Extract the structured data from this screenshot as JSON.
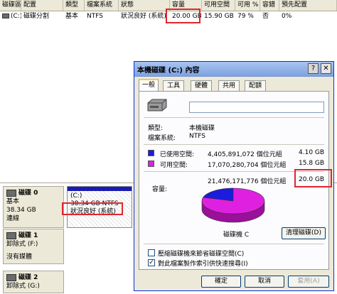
{
  "list": {
    "headers": [
      "磁碟區",
      "配置",
      "類型",
      "檔案系統",
      "狀態",
      "容量",
      "可用空間",
      "可用 %",
      "容錯",
      "預先配置"
    ],
    "row": [
      "(C:)",
      "磁碟分割",
      "基本",
      "NTFS",
      "狀況良好 (系統)",
      "20.00 GB",
      "15.90 GB",
      "79 %",
      "否",
      "0%"
    ]
  },
  "disks": [
    {
      "name": "磁碟 0",
      "type": "基本",
      "size": "38.34 GB",
      "status": "連線"
    },
    {
      "name": "磁碟 1",
      "type": "卸除式 (F:)",
      "size": "",
      "status": "沒有媒體"
    },
    {
      "name": "磁碟 2",
      "type": "卸除式 (G:)",
      "size": "",
      "status": ""
    }
  ],
  "partition": {
    "label": "(C:)",
    "size": "38.34 GB NTFS",
    "status": "狀況良好 (系統)"
  },
  "dialog": {
    "title": "本機磁碟 (C:) 內容",
    "tabs": [
      "一般",
      "工具",
      "硬體",
      "共用",
      "配額"
    ],
    "name_value": "",
    "type_label": "類型:",
    "type_value": "本機磁碟",
    "fs_label": "檔案系統:",
    "fs_value": "NTFS",
    "used_label": "已使用空間:",
    "used_bytes": "4,405,891,072 個位元組",
    "used_gb": "4.10 GB",
    "free_label": "可用空間:",
    "free_bytes": "17,070,280,704 個位元組",
    "free_gb": "15.8 GB",
    "cap_label": "容量:",
    "cap_bytes": "21,476,171,776 個位元組",
    "cap_gb": "20.0 GB",
    "drive_label": "磁碟機 C",
    "cleanup_button": "清理磁碟(D)",
    "compress_label": "壓縮磁碟機來節省磁碟空間(C)",
    "compress_checked": false,
    "index_label": "對此檔案製作索引供快速搜尋(I)",
    "index_checked": true,
    "ok_button": "確定",
    "cancel_button": "取消",
    "apply_button": "套用(A)",
    "used_fraction": 0.205,
    "colors": {
      "used": "#1c1cdc",
      "free": "#e020e0"
    }
  }
}
